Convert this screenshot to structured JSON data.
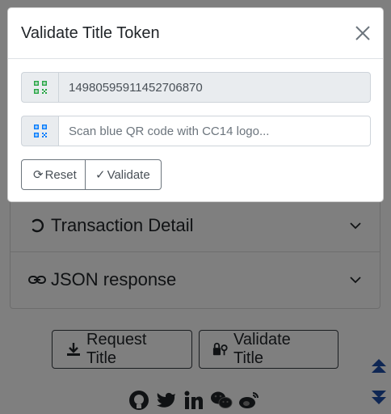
{
  "modal": {
    "title": "Validate Title Token",
    "token_value": "14980595911452706870",
    "qr_placeholder": "Scan blue QR code with CC14 logo...",
    "reset_label": "Reset",
    "validate_label": "Validate",
    "reset_glyph": "⟳",
    "validate_glyph": "✓"
  },
  "accordion": {
    "items": [
      {
        "label": "Transaction Detail",
        "icon": "spinner-icon"
      },
      {
        "label": "JSON response",
        "icon": "link-icon"
      }
    ]
  },
  "actions": {
    "request_title": "Request Title",
    "validate_title": "Validate Title"
  },
  "social": [
    "github-icon",
    "twitter-icon",
    "linkedin-icon",
    "wechat-icon",
    "weibo-icon"
  ],
  "colors": {
    "qr_green": "#28a745",
    "qr_blue": "#007bff",
    "scroll_blue": "#1e4fa8",
    "backdrop": "rgba(0,0,0,0.5)"
  }
}
